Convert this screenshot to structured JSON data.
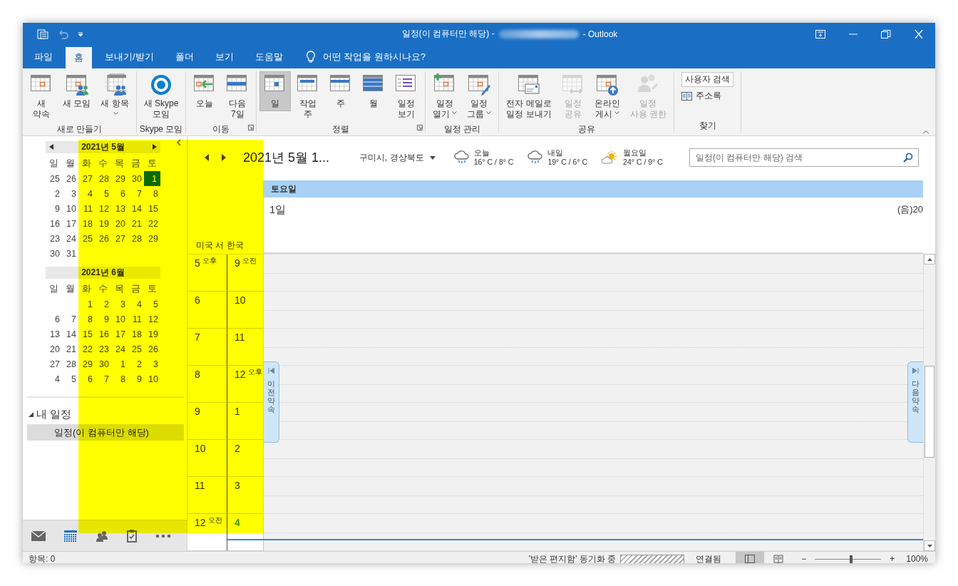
{
  "window": {
    "title_prefix": "일정(이 컴퓨터만 해당) -",
    "redacted": true,
    "title_suffix": "- Outlook"
  },
  "highlight_overlay": true,
  "tabs": [
    {
      "label": "파일",
      "selected": false
    },
    {
      "label": "홈",
      "selected": true
    },
    {
      "label": "보내기/받기",
      "selected": false
    },
    {
      "label": "폴더",
      "selected": false
    },
    {
      "label": "보기",
      "selected": false
    },
    {
      "label": "도움말",
      "selected": false
    }
  ],
  "tell_me": {
    "placeholder": "어떤 작업을 원하시나요?"
  },
  "ribbon": {
    "groups": [
      {
        "label": "새로 만들기",
        "buttons": [
          {
            "lines": [
              "새",
              "약속"
            ],
            "selected": false,
            "disabled": false
          },
          {
            "lines": [
              "새 모임"
            ],
            "selected": false,
            "disabled": false
          },
          {
            "lines": [
              "새 항목"
            ],
            "selected": false,
            "disabled": false,
            "dropdown": true
          }
        ]
      },
      {
        "label": "Skype 모임",
        "buttons": [
          {
            "lines": [
              "새 Skype",
              "모임"
            ],
            "selected": false,
            "disabled": false
          }
        ]
      },
      {
        "label": "이동",
        "launcher": true,
        "buttons": [
          {
            "lines": [
              "오늘"
            ],
            "selected": false,
            "disabled": false,
            "dropdown": false
          },
          {
            "lines": [
              "다음",
              "7일"
            ],
            "selected": false,
            "disabled": false,
            "dropdown": false
          }
        ]
      },
      {
        "label": "정렬",
        "launcher": true,
        "buttons": [
          {
            "lines": [
              "일"
            ],
            "selected": true,
            "disabled": false,
            "dropdown": false
          },
          {
            "lines": [
              "작업",
              "주"
            ],
            "selected": false,
            "disabled": false,
            "dropdown": false
          },
          {
            "lines": [
              "주"
            ],
            "selected": false,
            "disabled": false,
            "dropdown": false
          },
          {
            "lines": [
              "월"
            ],
            "selected": false,
            "disabled": false,
            "dropdown": false
          },
          {
            "lines": [
              "일정",
              "보기"
            ],
            "selected": false,
            "disabled": false,
            "dropdown": false
          }
        ]
      },
      {
        "label": "일정 관리",
        "buttons": [
          {
            "lines": [
              "일정",
              "열기"
            ],
            "selected": false,
            "disabled": false,
            "dropdown": true
          },
          {
            "lines": [
              "일정",
              "그룹"
            ],
            "selected": false,
            "disabled": false,
            "dropdown": true
          }
        ]
      },
      {
        "label": "공유",
        "buttons": [
          {
            "lines": [
              "전자 메일로",
              "일정 보내기"
            ],
            "selected": false,
            "disabled": false,
            "dropdown": false
          },
          {
            "lines": [
              "일정",
              "공유"
            ],
            "selected": false,
            "disabled": true,
            "dropdown": false
          },
          {
            "lines": [
              "온라인",
              "게시"
            ],
            "selected": false,
            "disabled": false,
            "dropdown": true
          },
          {
            "lines": [
              "일정",
              "사용 권한"
            ],
            "selected": false,
            "disabled": true,
            "dropdown": false
          }
        ]
      },
      {
        "label": "찾기",
        "search_people": {
          "label": "사용자 검색"
        },
        "address_book": {
          "label": "주소록"
        }
      }
    ]
  },
  "mini_calendars": [
    {
      "title": "2021년 5월",
      "arrows": true,
      "weekdays": [
        "일",
        "월",
        "화",
        "수",
        "목",
        "금",
        "토"
      ],
      "weeks": [
        [
          {
            "d": "25",
            "selected": false
          },
          {
            "d": "26",
            "selected": false
          },
          {
            "d": "27",
            "selected": false
          },
          {
            "d": "28",
            "selected": false
          },
          {
            "d": "29",
            "selected": false
          },
          {
            "d": "30",
            "selected": false
          },
          {
            "d": "1",
            "selected": true
          }
        ],
        [
          {
            "d": "2",
            "selected": false
          },
          {
            "d": "3",
            "selected": false
          },
          {
            "d": "4",
            "selected": false
          },
          {
            "d": "5",
            "selected": false
          },
          {
            "d": "6",
            "selected": false
          },
          {
            "d": "7",
            "selected": false
          },
          {
            "d": "8",
            "selected": false
          }
        ],
        [
          {
            "d": "9",
            "selected": false
          },
          {
            "d": "10",
            "selected": false
          },
          {
            "d": "11",
            "selected": false
          },
          {
            "d": "12",
            "selected": false
          },
          {
            "d": "13",
            "selected": false
          },
          {
            "d": "14",
            "selected": false
          },
          {
            "d": "15",
            "selected": false
          }
        ],
        [
          {
            "d": "16",
            "selected": false
          },
          {
            "d": "17",
            "selected": false
          },
          {
            "d": "18",
            "selected": false
          },
          {
            "d": "19",
            "selected": false
          },
          {
            "d": "20",
            "selected": false
          },
          {
            "d": "21",
            "selected": false
          },
          {
            "d": "22",
            "selected": false
          }
        ],
        [
          {
            "d": "23",
            "selected": false
          },
          {
            "d": "24",
            "selected": false
          },
          {
            "d": "25",
            "selected": false
          },
          {
            "d": "26",
            "selected": false
          },
          {
            "d": "27",
            "selected": false
          },
          {
            "d": "28",
            "selected": false
          },
          {
            "d": "29",
            "selected": false
          }
        ],
        [
          {
            "d": "30",
            "selected": false
          },
          {
            "d": "31",
            "selected": false
          }
        ]
      ]
    },
    {
      "title": "2021년 6월",
      "weekdays": [
        "일",
        "월",
        "화",
        "수",
        "목",
        "금",
        "토"
      ],
      "weeks": [
        [
          {
            "d": "1",
            "selected": false
          },
          {
            "d": "2",
            "selected": false
          },
          {
            "d": "3",
            "selected": false
          },
          {
            "d": "4",
            "selected": false
          },
          {
            "d": "5",
            "selected": false
          }
        ],
        [
          {
            "d": "6",
            "selected": false
          },
          {
            "d": "7",
            "selected": false
          },
          {
            "d": "8",
            "selected": false
          },
          {
            "d": "9",
            "selected": false
          },
          {
            "d": "10",
            "selected": false
          },
          {
            "d": "11",
            "selected": false
          },
          {
            "d": "12",
            "selected": false
          }
        ],
        [
          {
            "d": "13",
            "selected": false
          },
          {
            "d": "14",
            "selected": false
          },
          {
            "d": "15",
            "selected": false
          },
          {
            "d": "16",
            "selected": false
          },
          {
            "d": "17",
            "selected": false
          },
          {
            "d": "18",
            "selected": false
          },
          {
            "d": "19",
            "selected": false
          }
        ],
        [
          {
            "d": "20",
            "selected": false
          },
          {
            "d": "21",
            "selected": false
          },
          {
            "d": "22",
            "selected": false
          },
          {
            "d": "23",
            "selected": false
          },
          {
            "d": "24",
            "selected": false
          },
          {
            "d": "25",
            "selected": false
          },
          {
            "d": "26",
            "selected": false
          }
        ],
        [
          {
            "d": "27",
            "selected": false
          },
          {
            "d": "28",
            "selected": false
          },
          {
            "d": "29",
            "selected": false
          },
          {
            "d": "30",
            "selected": false
          },
          {
            "d": "1",
            "selected": false
          },
          {
            "d": "2",
            "selected": false
          },
          {
            "d": "3",
            "selected": false
          }
        ],
        [
          {
            "d": "4",
            "selected": false
          },
          {
            "d": "5",
            "selected": false
          },
          {
            "d": "6",
            "selected": false
          },
          {
            "d": "7",
            "selected": false
          },
          {
            "d": "8",
            "selected": false
          },
          {
            "d": "9",
            "selected": false
          },
          {
            "d": "10",
            "selected": false
          }
        ]
      ]
    }
  ],
  "my_calendars": {
    "label": "내 일정",
    "expanded": true,
    "items": [
      {
        "label": "일정(이 컴퓨터만 해당)",
        "selected": true
      }
    ]
  },
  "modules": [
    {
      "kind": "mail",
      "selected": false
    },
    {
      "kind": "calendar",
      "selected": true
    },
    {
      "kind": "people",
      "selected": false
    },
    {
      "kind": "tasks",
      "selected": false
    },
    {
      "kind": "more",
      "selected": false
    }
  ],
  "date_nav": {
    "title": "2021년 5월 1..."
  },
  "location": {
    "label": "구미시, 경상북도"
  },
  "weather": [
    {
      "day": "오늘",
      "temps": "16° C / 8° C",
      "kind": "rain"
    },
    {
      "day": "내일",
      "temps": "19° C / 6° C",
      "kind": "rain"
    },
    {
      "day": "월요일",
      "temps": "24° C / 9° C",
      "kind": "sunny"
    }
  ],
  "search": {
    "placeholder": "일정(이 컴퓨터만 해당) 검색"
  },
  "day_header": {
    "weekday": "토요일",
    "date": "1일",
    "lunar": "(음)20"
  },
  "time_zones": [
    "미국 서",
    "한국"
  ],
  "hours": [
    {
      "tz1": "5",
      "tz1_suffix": "오후",
      "tz2": "9",
      "tz2_suffix": "오전",
      "current": false
    },
    {
      "tz1": "6",
      "tz2": "10",
      "current": false
    },
    {
      "tz1": "7",
      "tz2": "11",
      "current": false
    },
    {
      "tz1": "8",
      "tz2": "12",
      "tz2_suffix": "오후",
      "current": false
    },
    {
      "tz1": "9",
      "tz2": "1",
      "current": false
    },
    {
      "tz1": "10",
      "tz2": "2",
      "current": false
    },
    {
      "tz1": "11",
      "tz2": "3",
      "current": false
    },
    {
      "tz1": "12",
      "tz1_suffix": "오전",
      "tz2": "4",
      "current": true
    }
  ],
  "prev_appointment": {
    "label": "이전 약속"
  },
  "next_appointment": {
    "label": "다음 약속"
  },
  "status_bar": {
    "items": "항목: 0",
    "sync": "'받은 편지함' 동기화 중",
    "syncing": true,
    "connection": "연결됨",
    "views": [
      {
        "selected": true
      },
      {
        "selected": false
      }
    ],
    "zoom_out": "−",
    "zoom_in": "+",
    "zoom": {
      "level": 0.54,
      "label": "100%"
    }
  }
}
